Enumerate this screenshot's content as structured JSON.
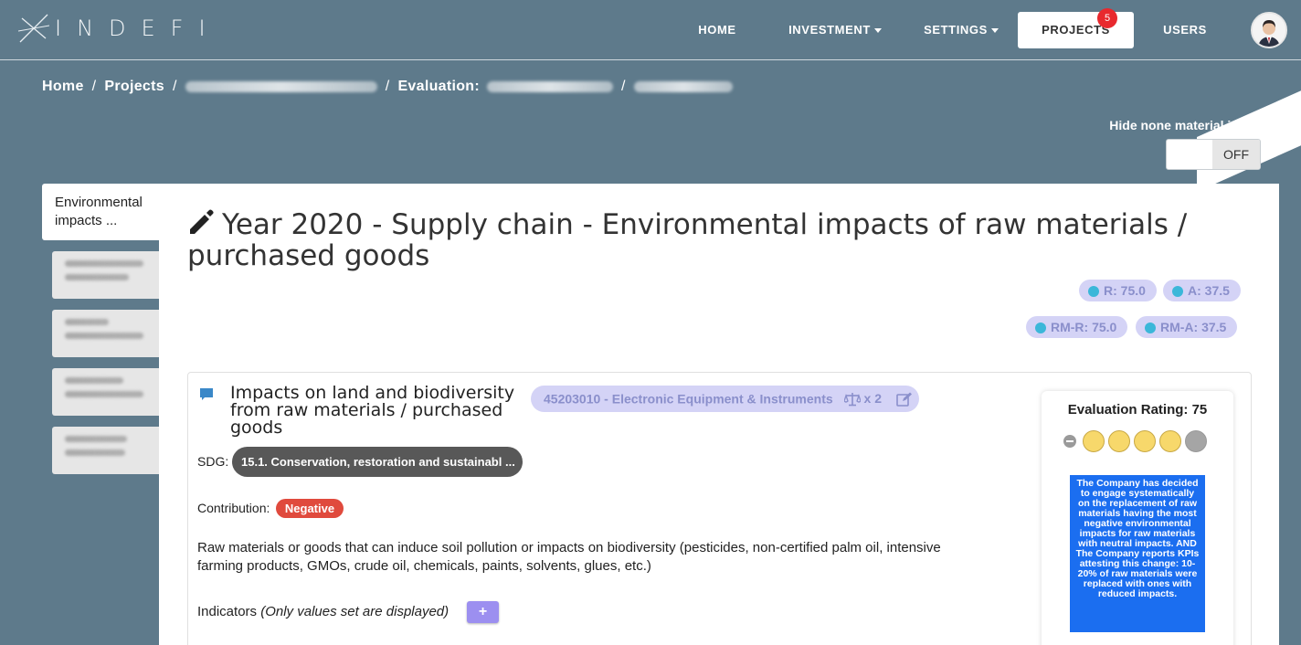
{
  "header": {
    "logo_text": "INDEFI",
    "nav": {
      "home": "HOME",
      "investment": "INVESTMENT",
      "settings": "SETTINGS",
      "projects": "PROJECTS",
      "projects_badge": "5",
      "users": "USERS"
    }
  },
  "breadcrumb": {
    "home": "Home",
    "projects": "Projects",
    "evaluation": "Evaluation:"
  },
  "filters": {
    "hide_label": "Hide none material items",
    "toggle_state": "OFF"
  },
  "sidebar": {
    "active_tab": "Environmental impacts ..."
  },
  "main": {
    "title": "Year 2020 - Supply chain - Environmental impacts of raw materials / purchased goods",
    "scores": {
      "r": "R: 75.0",
      "a": "A: 37.5",
      "rm_r": "RM-R: 75.0",
      "rm_a": "RM-A: 37.5"
    },
    "impact": {
      "title": "Impacts on land and biodiversity from raw materials / purchased goods",
      "sector": "45203010 - Electronic Equipment & Instruments",
      "sector_multiplier": "x 2",
      "sdg_label": "SDG:",
      "sdg_value": "15.1. Conservation, restoration and sustainabl ...",
      "contribution_label": "Contribution:",
      "contribution_value": "Negative",
      "description": "Raw materials or goods that can induce soil pollution or impacts on biodiversity (pesticides, non-certified palm oil, intensive farming products, GMOs, crude oil, chemicals, paints, solvents, glues, etc.)",
      "indicators_label": "Indicators",
      "indicators_note": "(Only values set are displayed)",
      "add_button": "+"
    },
    "rating": {
      "title": "Evaluation Rating: 75",
      "filled": 4,
      "total": 5,
      "text": "The Company has decided to engage systematically on the replacement of raw materials having the most negative environmental impacts for raw materials with neutral impacts. AND The Company reports KPIs attesting this change: 10-20% of raw materials were replaced with ones with reduced impacts."
    }
  },
  "colors": {
    "background": "#5e7a8b",
    "pill_bg": "#d4d3f6",
    "pill_text": "#8a8fcb",
    "negative": "#e04a3d",
    "rating_box": "#1b6ef0",
    "star": "#f7d86b"
  }
}
